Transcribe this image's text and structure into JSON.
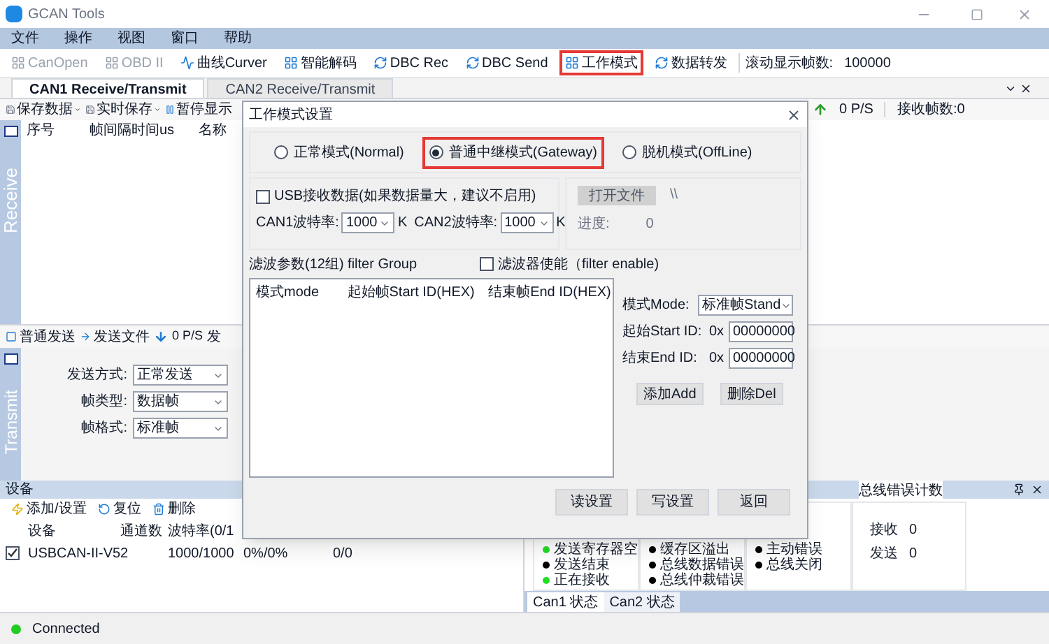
{
  "window": {
    "title": "GCAN Tools"
  },
  "menu": [
    "文件",
    "操作",
    "视图",
    "窗口",
    "帮助"
  ],
  "toolbar": [
    {
      "label": "CanOpen",
      "disabled": true,
      "highlighted": false
    },
    {
      "label": "OBD II",
      "disabled": true,
      "highlighted": false
    },
    {
      "label": "曲线Curver",
      "disabled": false,
      "highlighted": false
    },
    {
      "label": "智能解码",
      "disabled": false,
      "highlighted": false
    },
    {
      "label": "DBC Rec",
      "disabled": false,
      "highlighted": false
    },
    {
      "label": "DBC Send",
      "disabled": false,
      "highlighted": false
    },
    {
      "label": "工作模式",
      "disabled": false,
      "highlighted": true
    },
    {
      "label": "数据转发",
      "disabled": false,
      "highlighted": false
    }
  ],
  "scroll_frames": {
    "label": "滚动显示帧数:",
    "value": "100000"
  },
  "tabs": [
    {
      "label": "CAN1 Receive/Transmit",
      "selected": true
    },
    {
      "label": "CAN2 Receive/Transmit",
      "selected": false
    }
  ],
  "receive": {
    "side_label": "Receive",
    "toolbar": [
      "保存数据",
      "实时保存",
      "暂停显示"
    ],
    "rate": "0 P/S",
    "count": "接收帧数:0",
    "columns": [
      "序号",
      "帧间隔时间us",
      "名称"
    ]
  },
  "transmit": {
    "side_label": "Transmit",
    "toolbar": [
      "普通发送",
      "发送文件"
    ],
    "rate": "0 P/S",
    "cut_label": "发",
    "fields": [
      {
        "label": "发送方式:",
        "value": "正常发送"
      },
      {
        "label": "帧类型:",
        "value": "数据帧"
      },
      {
        "label": "帧格式:",
        "value": "标准帧"
      }
    ]
  },
  "devices": {
    "title": "设备",
    "toolbar": [
      "添加/设置",
      "复位",
      "删除"
    ],
    "columns": [
      "设备",
      "通道数",
      "波特率(0/1"
    ],
    "rows": [
      {
        "checked": true,
        "cells": [
          "USBCAN-II-V5",
          "2",
          "1000/1000",
          "0%/0%",
          "0/0"
        ]
      }
    ]
  },
  "status_panel": {
    "groups": [
      [
        {
          "label": "发送寄存器空",
          "color": "#22dd22"
        },
        {
          "label": "发送结束",
          "color": "#000000"
        },
        {
          "label": "正在接收",
          "color": "#22dd22"
        }
      ],
      [
        {
          "label": "缓存区溢出",
          "color": "#000000"
        },
        {
          "label": "总线数据错误",
          "color": "#000000"
        },
        {
          "label": "总线仲裁错误",
          "color": "#000000"
        }
      ],
      [
        {
          "label": "主动错误",
          "color": "#000000"
        },
        {
          "label": "总线关闭",
          "color": "#000000"
        }
      ]
    ],
    "error_count": {
      "title": "总线错误计数",
      "rows": [
        {
          "label": "接收",
          "value": "0"
        },
        {
          "label": "发送",
          "value": "0"
        }
      ]
    },
    "tabs": [
      {
        "label": "Can1 状态",
        "selected": true
      },
      {
        "label": "Can2 状态",
        "selected": false
      }
    ]
  },
  "status_bar": {
    "text": "Connected",
    "connected": true
  },
  "dialog": {
    "title": "工作模式设置",
    "modes": [
      {
        "label": "正常模式(Normal)",
        "selected": false,
        "highlighted": false
      },
      {
        "label": "普通中继模式(Gateway)",
        "selected": true,
        "highlighted": true
      },
      {
        "label": "脱机模式(OffLine)",
        "selected": false,
        "highlighted": false
      }
    ],
    "usb_receive": {
      "label": "USB接收数据(如果数据量大，建议不启用)",
      "checked": false
    },
    "baud": [
      {
        "label": "CAN1波特率:",
        "value": "1000",
        "unit": "K"
      },
      {
        "label": "CAN2波特率:",
        "value": "1000",
        "unit": "K"
      }
    ],
    "offline": {
      "button": "打开文件",
      "disabled": true,
      "path": "\\\\",
      "progress_label": "进度:",
      "progress_value": "0"
    },
    "filter_group": "滤波参数(12组) filter Group",
    "filter_enable": {
      "label": "滤波器使能（filter enable)",
      "checked": false
    },
    "filter_columns": [
      "模式mode",
      "起始帧Start ID(HEX)",
      "结束帧End ID(HEX)"
    ],
    "mode": {
      "label": "模式Mode:",
      "value": "标准帧Stand"
    },
    "ids": [
      {
        "label": "起始Start ID:",
        "prefix": "0x",
        "value": "00000000"
      },
      {
        "label": "结束End ID:",
        "prefix": "0x",
        "value": "00000000"
      }
    ],
    "filter_buttons": [
      "添加Add",
      "删除Del"
    ],
    "buttons": [
      "读设置",
      "写设置",
      "返回"
    ]
  }
}
